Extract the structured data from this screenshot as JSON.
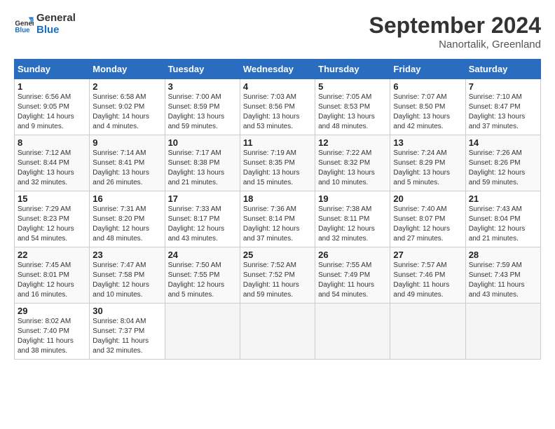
{
  "header": {
    "logo_line1": "General",
    "logo_line2": "Blue",
    "month": "September 2024",
    "location": "Nanortalik, Greenland"
  },
  "days_of_week": [
    "Sunday",
    "Monday",
    "Tuesday",
    "Wednesday",
    "Thursday",
    "Friday",
    "Saturday"
  ],
  "weeks": [
    [
      {
        "day": "1",
        "info": "Sunrise: 6:56 AM\nSunset: 9:05 PM\nDaylight: 14 hours\nand 9 minutes."
      },
      {
        "day": "2",
        "info": "Sunrise: 6:58 AM\nSunset: 9:02 PM\nDaylight: 14 hours\nand 4 minutes."
      },
      {
        "day": "3",
        "info": "Sunrise: 7:00 AM\nSunset: 8:59 PM\nDaylight: 13 hours\nand 59 minutes."
      },
      {
        "day": "4",
        "info": "Sunrise: 7:03 AM\nSunset: 8:56 PM\nDaylight: 13 hours\nand 53 minutes."
      },
      {
        "day": "5",
        "info": "Sunrise: 7:05 AM\nSunset: 8:53 PM\nDaylight: 13 hours\nand 48 minutes."
      },
      {
        "day": "6",
        "info": "Sunrise: 7:07 AM\nSunset: 8:50 PM\nDaylight: 13 hours\nand 42 minutes."
      },
      {
        "day": "7",
        "info": "Sunrise: 7:10 AM\nSunset: 8:47 PM\nDaylight: 13 hours\nand 37 minutes."
      }
    ],
    [
      {
        "day": "8",
        "info": "Sunrise: 7:12 AM\nSunset: 8:44 PM\nDaylight: 13 hours\nand 32 minutes."
      },
      {
        "day": "9",
        "info": "Sunrise: 7:14 AM\nSunset: 8:41 PM\nDaylight: 13 hours\nand 26 minutes."
      },
      {
        "day": "10",
        "info": "Sunrise: 7:17 AM\nSunset: 8:38 PM\nDaylight: 13 hours\nand 21 minutes."
      },
      {
        "day": "11",
        "info": "Sunrise: 7:19 AM\nSunset: 8:35 PM\nDaylight: 13 hours\nand 15 minutes."
      },
      {
        "day": "12",
        "info": "Sunrise: 7:22 AM\nSunset: 8:32 PM\nDaylight: 13 hours\nand 10 minutes."
      },
      {
        "day": "13",
        "info": "Sunrise: 7:24 AM\nSunset: 8:29 PM\nDaylight: 13 hours\nand 5 minutes."
      },
      {
        "day": "14",
        "info": "Sunrise: 7:26 AM\nSunset: 8:26 PM\nDaylight: 12 hours\nand 59 minutes."
      }
    ],
    [
      {
        "day": "15",
        "info": "Sunrise: 7:29 AM\nSunset: 8:23 PM\nDaylight: 12 hours\nand 54 minutes."
      },
      {
        "day": "16",
        "info": "Sunrise: 7:31 AM\nSunset: 8:20 PM\nDaylight: 12 hours\nand 48 minutes."
      },
      {
        "day": "17",
        "info": "Sunrise: 7:33 AM\nSunset: 8:17 PM\nDaylight: 12 hours\nand 43 minutes."
      },
      {
        "day": "18",
        "info": "Sunrise: 7:36 AM\nSunset: 8:14 PM\nDaylight: 12 hours\nand 37 minutes."
      },
      {
        "day": "19",
        "info": "Sunrise: 7:38 AM\nSunset: 8:11 PM\nDaylight: 12 hours\nand 32 minutes."
      },
      {
        "day": "20",
        "info": "Sunrise: 7:40 AM\nSunset: 8:07 PM\nDaylight: 12 hours\nand 27 minutes."
      },
      {
        "day": "21",
        "info": "Sunrise: 7:43 AM\nSunset: 8:04 PM\nDaylight: 12 hours\nand 21 minutes."
      }
    ],
    [
      {
        "day": "22",
        "info": "Sunrise: 7:45 AM\nSunset: 8:01 PM\nDaylight: 12 hours\nand 16 minutes."
      },
      {
        "day": "23",
        "info": "Sunrise: 7:47 AM\nSunset: 7:58 PM\nDaylight: 12 hours\nand 10 minutes."
      },
      {
        "day": "24",
        "info": "Sunrise: 7:50 AM\nSunset: 7:55 PM\nDaylight: 12 hours\nand 5 minutes."
      },
      {
        "day": "25",
        "info": "Sunrise: 7:52 AM\nSunset: 7:52 PM\nDaylight: 11 hours\nand 59 minutes."
      },
      {
        "day": "26",
        "info": "Sunrise: 7:55 AM\nSunset: 7:49 PM\nDaylight: 11 hours\nand 54 minutes."
      },
      {
        "day": "27",
        "info": "Sunrise: 7:57 AM\nSunset: 7:46 PM\nDaylight: 11 hours\nand 49 minutes."
      },
      {
        "day": "28",
        "info": "Sunrise: 7:59 AM\nSunset: 7:43 PM\nDaylight: 11 hours\nand 43 minutes."
      }
    ],
    [
      {
        "day": "29",
        "info": "Sunrise: 8:02 AM\nSunset: 7:40 PM\nDaylight: 11 hours\nand 38 minutes."
      },
      {
        "day": "30",
        "info": "Sunrise: 8:04 AM\nSunset: 7:37 PM\nDaylight: 11 hours\nand 32 minutes."
      },
      {
        "day": "",
        "info": ""
      },
      {
        "day": "",
        "info": ""
      },
      {
        "day": "",
        "info": ""
      },
      {
        "day": "",
        "info": ""
      },
      {
        "day": "",
        "info": ""
      }
    ]
  ]
}
